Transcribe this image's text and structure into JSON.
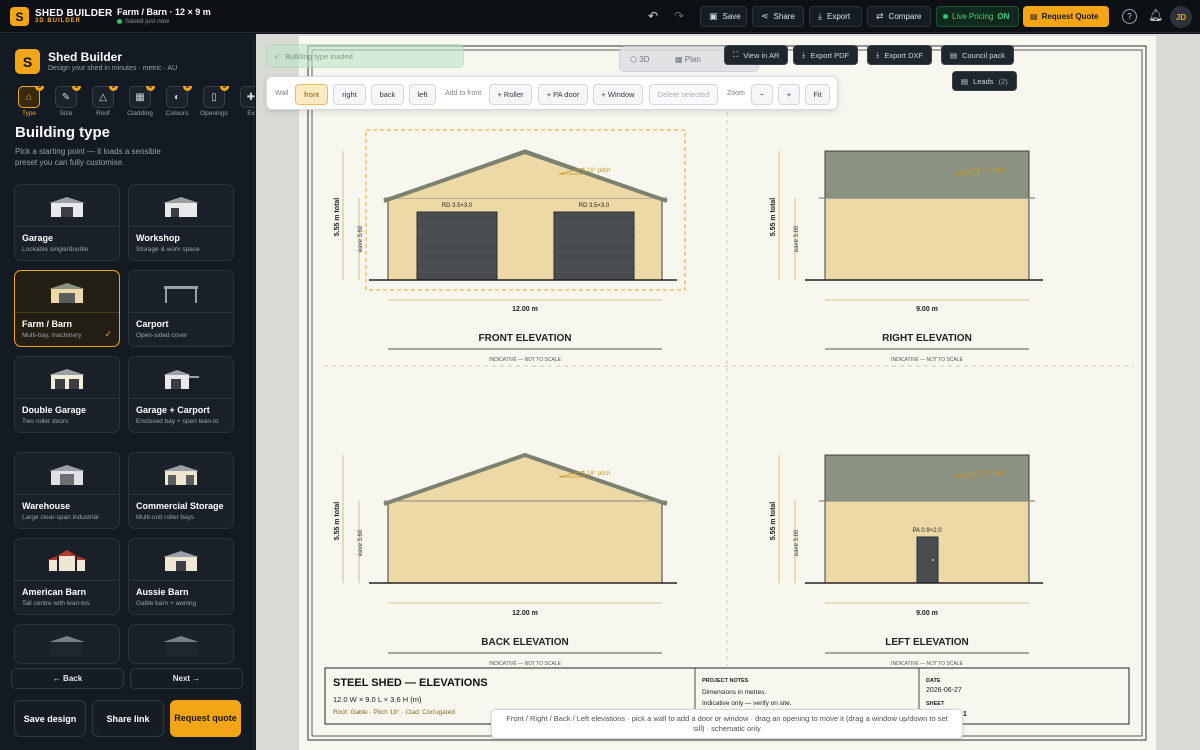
{
  "topbar": {
    "brand": "SHED BUILDER",
    "brand_sub": "3D BUILDER",
    "project": "Farm / Barn · 12 × 9 m",
    "saved": "Saved just now",
    "save": "Save",
    "share": "Share",
    "export": "Export",
    "compare": "Compare",
    "live_label": "Live Pricing",
    "live_state": "ON",
    "request_quote": "Request Quote",
    "avatar": "JD"
  },
  "sidebar": {
    "title": "Shed Builder",
    "subtitle": "Design your shed in minutes · metric · AU",
    "steps": [
      {
        "label": "Type",
        "badge": "0",
        "icon": "home-icon"
      },
      {
        "label": "Size",
        "badge": "0",
        "icon": "ruler-icon"
      },
      {
        "label": "Roof",
        "badge": "0",
        "icon": "roof-icon"
      },
      {
        "label": "Cladding",
        "badge": "0",
        "icon": "cladding-icon"
      },
      {
        "label": "Colours",
        "badge": "0",
        "icon": "palette-icon"
      },
      {
        "label": "Openings",
        "badge": "3",
        "icon": "door-icon"
      },
      {
        "label": "Ex",
        "badge": "",
        "icon": "extras-icon"
      }
    ],
    "heading": "Building type",
    "description": "Pick a starting point — it loads a sensible preset you can fully customise.",
    "cards": [
      {
        "name": "Garage",
        "desc": "Lockable single/double"
      },
      {
        "name": "Workshop",
        "desc": "Storage & work space"
      },
      {
        "name": "Farm / Barn",
        "desc": "Multi-bay, machinery"
      },
      {
        "name": "Carport",
        "desc": "Open-sided cover"
      },
      {
        "name": "Double Garage",
        "desc": "Two roller doors"
      },
      {
        "name": "Garage + Carport",
        "desc": "Enclosed bay + open lean-to"
      },
      {
        "name": "Warehouse",
        "desc": "Large clear-span industrial"
      },
      {
        "name": "Commercial Storage",
        "desc": "Multi-unit roller bays"
      },
      {
        "name": "American Barn",
        "desc": "Tall centre with lean-tos"
      },
      {
        "name": "Aussie Barn",
        "desc": "Gable barn + awning"
      }
    ],
    "back": "← Back",
    "next": "Next →",
    "save_design": "Save design",
    "share_link": "Share link",
    "request_quote": "Request quote"
  },
  "canvas": {
    "toast": "Building type loaded",
    "view_3d": "3D",
    "view_plan": "Plan",
    "view_ar": "View in AR",
    "export_pdf": "Export PDF",
    "export_dxf": "Export DXF",
    "council_pack": "Council pack",
    "leads": "Leads",
    "leads_count": "(2)",
    "toolbar": {
      "wall_label": "Wall",
      "walls": [
        "front",
        "right",
        "back",
        "left"
      ],
      "add_label": "Add to front",
      "roller": "+ Roller",
      "pa_door": "+ PA door",
      "window": "+ Window",
      "delete": "Delete selected",
      "zoom_label": "Zoom",
      "zoom_out": "−",
      "zoom_in": "+",
      "fit": "Fit"
    },
    "hint": "Front / Right / Back / Left elevations · pick a wall to add a door or window · drag an opening to move it (drag a window up/down to set sill) · schematic only"
  },
  "drawing": {
    "front": {
      "title": "FRONT ELEVATION",
      "width": "12.00 m",
      "total": "5.55 m total",
      "eave": "eave 3.60",
      "pitch": "18° pitch",
      "door1": "RD 3.5×3.0",
      "door2": "RD 3.5×3.0"
    },
    "right": {
      "title": "RIGHT ELEVATION",
      "width": "9.00 m",
      "total": "5.55 m total",
      "eave": "eave 3.60",
      "pitch": "18° pitch"
    },
    "back": {
      "title": "BACK ELEVATION",
      "width": "12.00 m",
      "total": "5.55 m total",
      "eave": "eave 3.60",
      "pitch": "18° pitch"
    },
    "left": {
      "title": "LEFT ELEVATION",
      "width": "9.00 m",
      "total": "5.55 m total",
      "eave": "eave 3.60",
      "pitch": "18° pitch",
      "door": "PA 0.9×2.0"
    },
    "indicative": "INDICATIVE — NOT TO SCALE",
    "title_block": {
      "title": "STEEL SHED — ELEVATIONS",
      "dims": "12.0 W × 9.0 L × 3.6 H (m)",
      "spec": "Roof: Gable · Pitch 18° · Clad: Corrugated",
      "notes_head": "PROJECT NOTES",
      "note1": "Dimensions in metres.",
      "note2": "Indicative only — verify on site.",
      "date_head": "DATE",
      "date": "2026-06-27",
      "sheet_head": "SHEET",
      "sheet": "1"
    }
  },
  "colors": {
    "accent": "#f2a516",
    "wall_fill": "#ecd9a6",
    "roof_grey": "#8c9281",
    "door_dark": "#4a4d50",
    "live_green": "#3fd07e"
  }
}
